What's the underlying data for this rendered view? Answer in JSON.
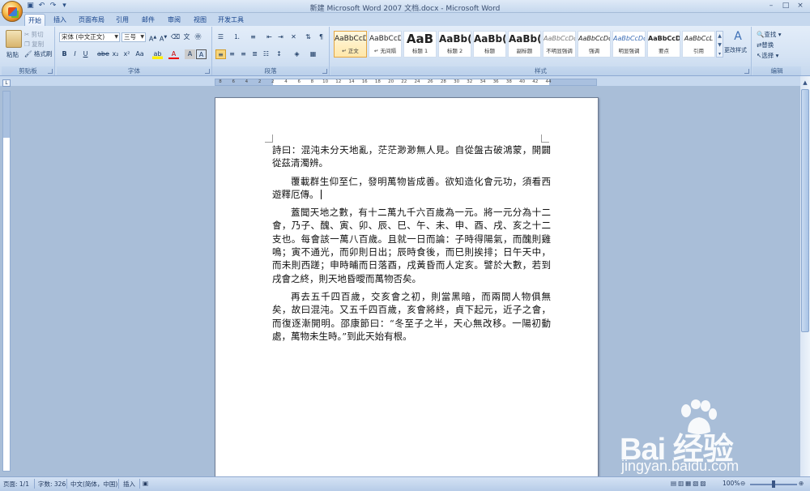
{
  "window": {
    "title": "新建 Microsoft Word 2007 文档.docx - Microsoft Word",
    "controls": [
      "–",
      "□",
      "×"
    ]
  },
  "tabs": [
    "开始",
    "插入",
    "页面布局",
    "引用",
    "邮件",
    "审阅",
    "视图",
    "开发工具"
  ],
  "active_tab": "开始",
  "clipboard": {
    "label": "剪贴板",
    "paste": "粘贴",
    "cut": "剪切",
    "copy": "复制",
    "format_painter": "格式刷"
  },
  "font_group": {
    "label": "字体",
    "font_name": "宋体 (中文正文)",
    "font_size": "三号"
  },
  "paragraph_group": {
    "label": "段落"
  },
  "styles": {
    "label": "样式",
    "items": [
      {
        "sample": "AaBbCcD",
        "name": "↵ 正文"
      },
      {
        "sample": "AaBbCcD",
        "name": "↵ 无间隔"
      },
      {
        "sample": "AaB",
        "name": "标题 1"
      },
      {
        "sample": "AaBb(",
        "name": "标题 2"
      },
      {
        "sample": "AaBb(",
        "name": "标题"
      },
      {
        "sample": "AaBb(",
        "name": "副标题"
      },
      {
        "sample": "AaBbCcDc",
        "name": "不明显强调"
      },
      {
        "sample": "AaBbCcDc",
        "name": "强调"
      },
      {
        "sample": "AaBbCcDc",
        "name": "明显强调"
      },
      {
        "sample": "AaBbCcDc",
        "name": "要点"
      },
      {
        "sample": "AaBbCcL",
        "name": "引用"
      }
    ],
    "change_styles": "更改样式"
  },
  "editing": {
    "label": "编辑",
    "find": "查找",
    "replace": "替换",
    "select": "选择"
  },
  "ruler_numbers": [
    "8",
    "6",
    "4",
    "2",
    "2",
    "4",
    "6",
    "8",
    "10",
    "12",
    "14",
    "16",
    "18",
    "20",
    "22",
    "24",
    "26",
    "28",
    "30",
    "32",
    "34",
    "36",
    "38",
    "40",
    "42",
    "44"
  ],
  "document": {
    "paragraphs": [
      "詩曰：混沌未分天地亂，茫茫渺渺無人見。自從盤古破鴻蒙，開闢從茲清濁辨。",
      "覆載群生仰至仁，發明萬物皆成善。欲知造化會元功，須看西遊釋厄傳。",
      "蓋聞天地之數，有十二萬九千六百歲為一元。將一元分為十二會，乃子、醜、寅、卯、辰、巳、午、未、申、酉、戌、亥之十二支也。每會該一萬八百歲。且就一日而論：子時得陽氣，而醜則雞鳴；寅不通光，而卯則日出；辰時食後，而巳則挨排；日午天中，而未則西蹉；申時晡而日落酉，戌黃昏而人定亥。譬於大數，若到戌會之終，則天地昏曖而萬物否矣。",
      "再去五千四百歲，交亥會之初，則當黑暗，而兩間人物俱無矣，故曰混沌。又五千四百歲，亥會將終，貞下起元，近子之會，而復逐漸開明。邵康節曰：“冬至子之半，天心無改移。一陽初動處，萬物未生時。”到此天始有根。"
    ]
  },
  "status": {
    "page": "页面: 1/1",
    "words": "字数: 326",
    "language": "中文(简体，中国)",
    "mode": "插入",
    "zoom": "100%"
  },
  "watermark": {
    "brand": "Bai  经验",
    "url": "jingyan.baidu.com"
  }
}
